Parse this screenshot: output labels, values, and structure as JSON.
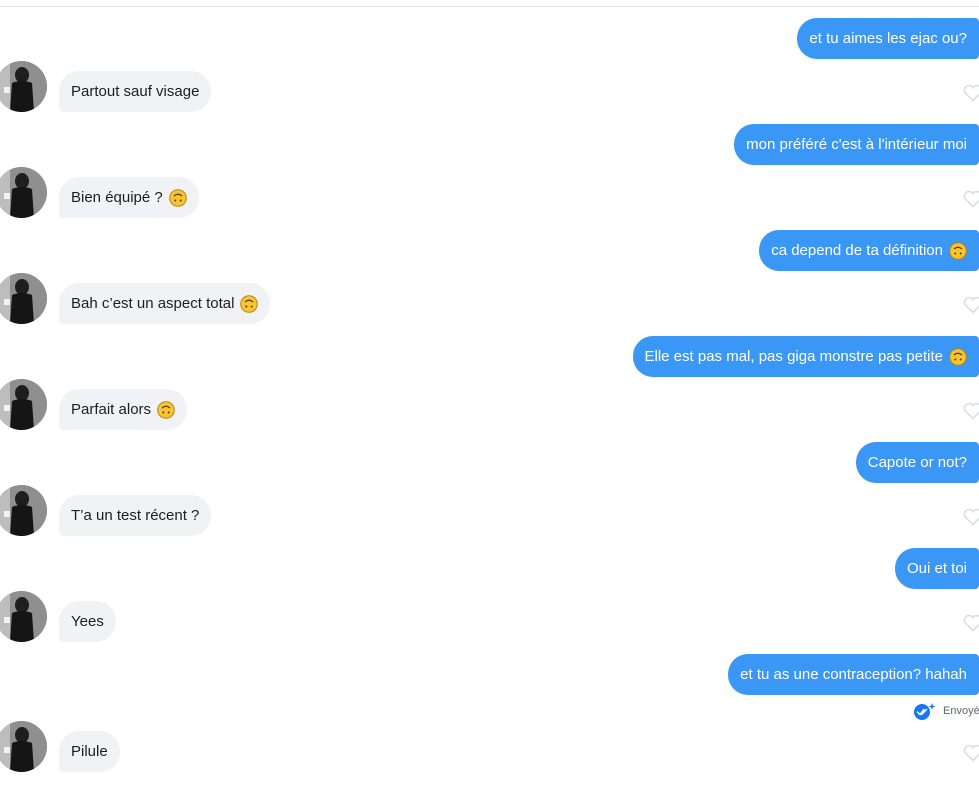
{
  "conversation": {
    "messages": [
      {
        "id": "m1",
        "side": "out",
        "text": "et tu aimes les ejac ou?",
        "emoji": ""
      },
      {
        "id": "m2",
        "side": "in",
        "text": "Partout sauf visage",
        "emoji": ""
      },
      {
        "id": "m3",
        "side": "out",
        "text": "mon préféré c'est à l'intérieur moi",
        "emoji": ""
      },
      {
        "id": "m4",
        "side": "in",
        "text": "Bien équipé ?",
        "emoji": "upside-down-face"
      },
      {
        "id": "m5",
        "side": "out",
        "text": "ca depend de ta définition",
        "emoji": "upside-down-face"
      },
      {
        "id": "m6",
        "side": "in",
        "text": "Bah c’est un aspect total",
        "emoji": "upside-down-face"
      },
      {
        "id": "m7",
        "side": "out",
        "text": "Elle est pas mal, pas giga monstre pas petite",
        "emoji": "upside-down-face"
      },
      {
        "id": "m8",
        "side": "in",
        "text": "Parfait alors",
        "emoji": "upside-down-face"
      },
      {
        "id": "m9",
        "side": "out",
        "text": "Capote or not?",
        "emoji": ""
      },
      {
        "id": "m10",
        "side": "in",
        "text": "T’a un test récent ?",
        "emoji": ""
      },
      {
        "id": "m11",
        "side": "out",
        "text": "Oui et toi",
        "emoji": ""
      },
      {
        "id": "m12",
        "side": "in",
        "text": "Yees",
        "emoji": ""
      },
      {
        "id": "m13",
        "side": "out",
        "text": "et tu as une contraception? hahah",
        "emoji": ""
      },
      {
        "id": "m14",
        "side": "in",
        "text": "Pilule",
        "emoji": ""
      }
    ],
    "status": {
      "label": "Envoyé",
      "icon": "double-check-icon"
    }
  },
  "colors": {
    "outgoing_bubble": "#3b97f5",
    "incoming_bubble": "#f0f2f5",
    "outgoing_text": "#ffffff",
    "incoming_text": "#1c1e21",
    "status_icon": "#1877f2"
  }
}
